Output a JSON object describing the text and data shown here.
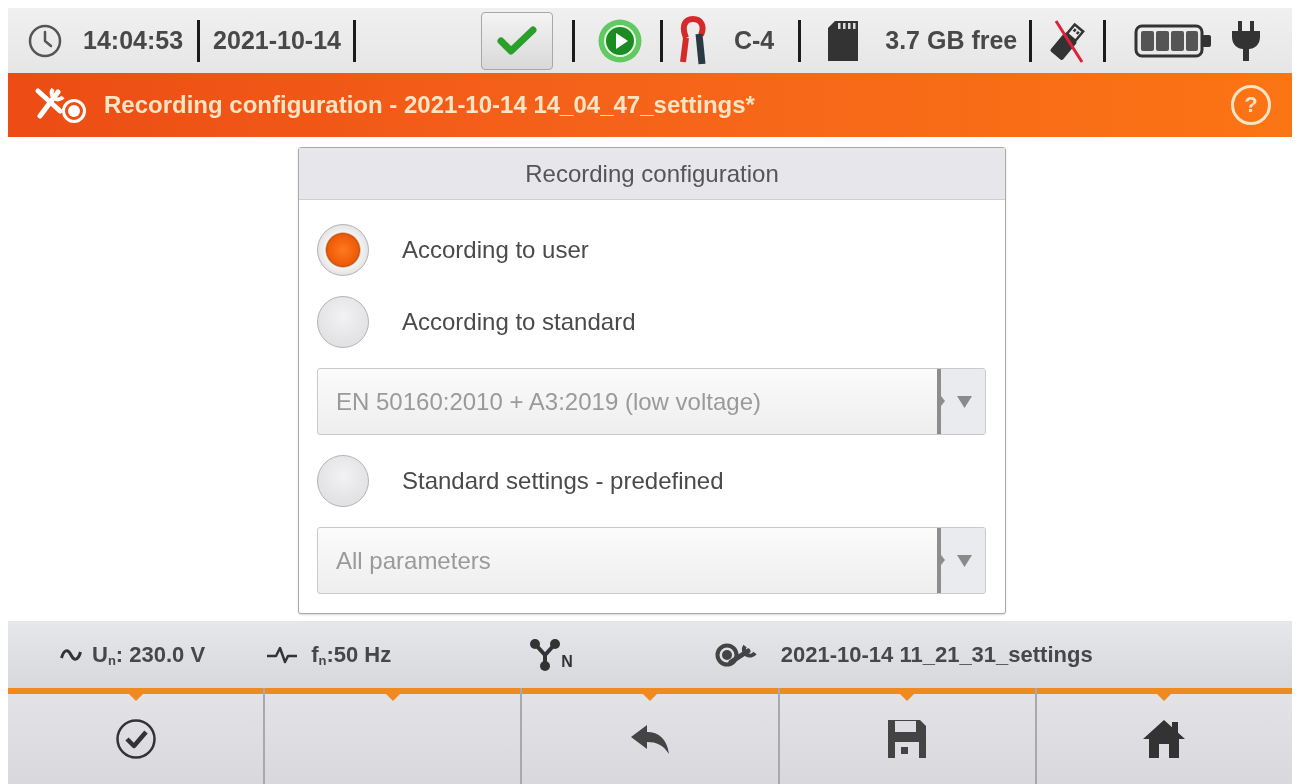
{
  "status_bar": {
    "time": "14:04:53",
    "date": "2021-10-14",
    "clamp": "C-4",
    "storage": "3.7 GB free",
    "usb_connected": false
  },
  "title_bar": {
    "title": "Recording configuration - 2021-10-14 14_04_47_settings*",
    "help": "?"
  },
  "dialog": {
    "title": "Recording configuration",
    "options": [
      {
        "label": "According to user",
        "selected": true
      },
      {
        "label": "According to standard",
        "selected": false,
        "dropdown": {
          "value": "EN 50160:2010 + A3:2019 (low voltage)",
          "disabled": true
        }
      },
      {
        "label": "Standard settings - predefined",
        "selected": false,
        "dropdown": {
          "value": "All parameters",
          "disabled": true
        }
      }
    ]
  },
  "info_bar": {
    "nominal_voltage": "U$_{n}$: 230.0 V",
    "nominal_frequency": "f$_{n}$:50 Hz",
    "network_label": "N",
    "settings_file": "2021-10-14 11_21_31_settings"
  },
  "buttons": [
    {
      "kind": "confirm"
    },
    {
      "kind": "empty"
    },
    {
      "kind": "back"
    },
    {
      "kind": "save"
    },
    {
      "kind": "home"
    }
  ]
}
